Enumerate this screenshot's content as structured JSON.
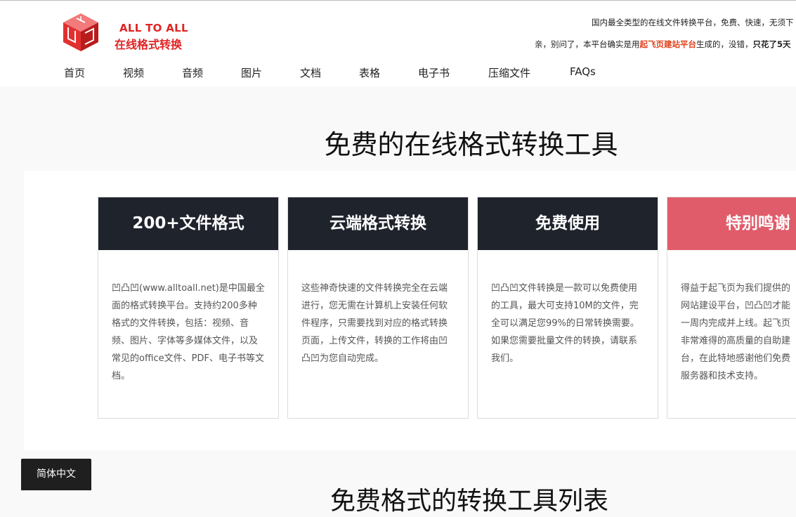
{
  "header": {
    "logo_en": "ALL TO ALL",
    "logo_cn": "在线格式转换",
    "tagline": "国内最全类型的在线文件转换平台，免费、快速，无须下",
    "notice": {
      "prefix": "亲，别问了，本平台确实是用",
      "link": "起飞页建站平台",
      "middle": "生成的，没错，",
      "bold": "只花了5天"
    }
  },
  "nav": {
    "items": [
      {
        "label": "首页",
        "name": "nav-item-home"
      },
      {
        "label": "视频",
        "name": "nav-item-video"
      },
      {
        "label": "音频",
        "name": "nav-item-audio"
      },
      {
        "label": "图片",
        "name": "nav-item-image"
      },
      {
        "label": "文档",
        "name": "nav-item-document"
      },
      {
        "label": "表格",
        "name": "nav-item-spreadsheet"
      },
      {
        "label": "电子书",
        "name": "nav-item-ebook"
      },
      {
        "label": "压缩文件",
        "name": "nav-item-archive"
      },
      {
        "label": "FAQs",
        "name": "nav-item-faqs"
      }
    ]
  },
  "main": {
    "title": "免费的在线格式转换工具",
    "cards": [
      {
        "title": "200+文件格式",
        "body": "凹凸凹(www.alltoall.net)是中国最全面的格式转换平台。支持约200多种格式的文件转换，包括：视频、音频、图片、字体等多媒体文件，以及常见的office文件、PDF、电子书等文档。"
      },
      {
        "title": "云端格式转换",
        "body": "这些神奇快速的文件转换完全在云端进行，您无需在计算机上安装任何软件程序，只需要找到对应的格式转换页面，上传文件，转换的工作将由凹凸凹为您自动完成。"
      },
      {
        "title": "免费使用",
        "body": "凹凸凹文件转换是一款可以免费使用的工具，最大可支持10M的文件，完全可以满足您99%的日常转换需要。如果您需要批量文件的转换，请联系我们。"
      },
      {
        "title": "特别鸣谢",
        "lines": [
          "得益于起飞页为我们提供的",
          "网站建设平台，凹凸凹才能",
          "一周内完成并上线。起飞页",
          "非常难得的高质量的自助建",
          "台，在此特地感谢他们免费",
          "服务器和技术支持。"
        ]
      }
    ],
    "subtitle": "免费格式的转换工具列表"
  },
  "language_button": "简体中文",
  "colors": {
    "brand_red": "#e02424",
    "card_dark": "#1f232c",
    "card_accent": "#e05c6a",
    "highlight_orange": "#e0411c"
  }
}
